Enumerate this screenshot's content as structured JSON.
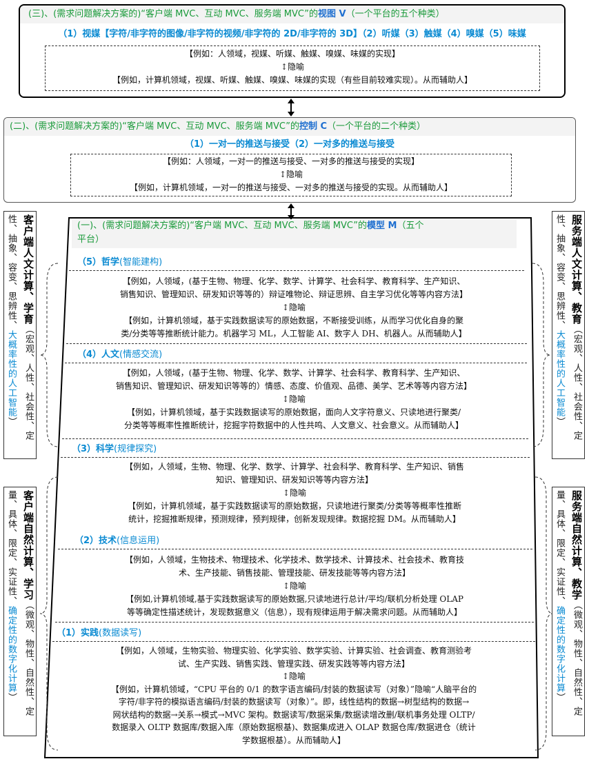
{
  "view": {
    "header_prefix": "(三)、(需求问题解决方案的)“客户端 MVC、互动 MVC、服务端 MVC”的",
    "header_bold": "视图 V",
    "header_suffix": "（一个平台的五个种类）",
    "sub": "（1）视媒【字符/非字符的图像/非字符的视频/非字符的 2D/非字符的 3D】（2）听媒（3）触媒（4）嗅媒（5）味媒",
    "human": "【例如：人领域，视媒、听媒、触媒、嗅媒、味媒的实现】",
    "metaphor": "↕隐喻",
    "machine": "【例如，计算机领域，视媒、听媒、触媒、嗅媒、味媒的实现（有些目前较难实现）。从而辅助人】"
  },
  "control": {
    "header_prefix": "(二)、(需求问题解决方案的)“客户端 MVC、互动 MVC、服务端 MVC”的",
    "header_bold": "控制 C",
    "header_suffix": "（一个平台的二个种类）",
    "sub": "（1）一对一的推送与接受（2）一对多的推送与接受",
    "human": "【例如：人领域，一对一的推送与接受、一对多的推送与接受的实现】",
    "metaphor": "↕隐喻",
    "machine": "【例如，计算机领域，一对一的推送与接受、一对多的推送与接受的实现。从而辅助人】"
  },
  "model": {
    "header_line1_prefix": "(一)、(需求问题解决方案的)“客户端 MVC、互动 MVC、服务端 MVC”的",
    "header_bold": "模型 M",
    "header_line1_suffix": "（五个",
    "header_line2": "平台）",
    "sections": [
      {
        "title": "（5）哲学",
        "note": "(智能建构)",
        "human": [
          "【例如，人领域，(基于生物、物理、化学、数学、计算学、社会科学、教育科学、生产知识、",
          "销售知识、管理知识、研发知识等等的）辩证唯物论、辩证思辨、自主学习优化等等内容方法】"
        ],
        "metaphor": "↕隐喻",
        "machine": [
          "【例如，计算机领域，基于实践数据读写的原始数据，不断接受训练，从而学习优化自身的聚",
          "类/分类等等推断统计能力。机器学习 ML，人工智能 AI、数字人 DH、机器人。从而辅助人】"
        ]
      },
      {
        "title": "（4）人文",
        "note": "(情感交流)",
        "human": [
          "【例如，人领域，(基于生物、物理、化学、数学、计算学、社会科学、教育科学、生产知识、",
          "销售知识、管理知识、研发知识等等的）情感、态度、价值观、品德、美学、艺术等等内容方法】"
        ],
        "metaphor": "↕隐喻",
        "machine": [
          "【例如，计算机领域，基于实践数据读写的原始数据，面向人文字符意义、只读地进行聚类/",
          "分类等等概率性推断统计，挖掘字符数据中的人性共鸣、人文意义、社会意义。从而辅助人】"
        ]
      },
      {
        "title": "（3）科学",
        "note": "(规律探究)",
        "human": [
          "【例如，人领域，生物、物理、化学、数学、计算学、社会科学、教育科学、生产知识、销售",
          "知识、管理知识、研发知识等等内容方法】"
        ],
        "metaphor": "↕隐喻",
        "machine": [
          "【例如，计算机领域，基于实践数据读写的原始数据，只读地进行聚类/分类等等概率性推断",
          "统计，挖掘推断规律，预测规律，预判规律，创新发现规律。数据挖掘 DM。从而辅助人】"
        ]
      },
      {
        "title": "（2）技术",
        "note": "(信息运用)",
        "human": [
          "【例如，人领域，生物技术、物理技术、化学技术、数学技术、计算技术、社会技术、教育技",
          "术、生产技能、销售技能、管理技能、研发技能等等内容方法】"
        ],
        "metaphor": "↕隐喻",
        "machine": [
          "【例如,计算机领域,基于实践数据读写的原始数据,只读地进行总计/平均/联机分析处理 OLAP",
          "等等确定性描述统计，发现数据意义（信息），现有规律运用于解决需求问题。从而辅助人】"
        ]
      },
      {
        "title": "（1）实践",
        "note": "(数据读写)",
        "human": [
          "【例如，人领域，生物实验、物理实验、化学实验、数学实验、计算实验、社会调查、教育测验考",
          "试、生产实践、销售实践、管理实践、研发实践等等内容方法】"
        ],
        "metaphor": "↕隐喻",
        "machine": [
          "【例如，计算机领域，“CPU 平台的 0/1 的数字语言编码/封装的数据读写（对象）”隐喻“人脑平台的",
          "字符/非字符的模拟语言编码/封装的数据读写（对象）”。即，线性结构的数据→树型结构的数据→",
          "网状结构的数据→关系→模式→MVC 架构。数据读写/数据采集/数据读增改删/联机事务处理 OLTP/",
          "数据录入 OLTP 数据库/数据入库（原始数据根基)、数据集成进入 OLAP 数据仓库/数据进仓（统计",
          "学数据根基）。从而辅助人】"
        ]
      }
    ]
  },
  "side": {
    "left_top": {
      "bold": "客户端人文计算、学育",
      "prefix": "性、抽象、容变、思辨性、",
      "mid": "（宏观、人性、社会性、定",
      "blue": "大概率性的人工智能",
      "end": "）"
    },
    "right_top": {
      "bold": "服务端人文计算、教育",
      "prefix": "性、抽象、容变、思辨性、",
      "mid": "（宏观、人性、社会性、定",
      "blue": "大概率性的人工智能",
      "end": "）"
    },
    "left_bottom": {
      "bold": "客户端自然计算、学习",
      "prefix": "量、具体、限定、实证性、",
      "mid": "（微观、物性、自然性、定",
      "blue": "确定性的数字化计算",
      "end": "）"
    },
    "right_bottom": {
      "bold": "服务端自然计算、教学",
      "prefix": "量、具体、限定、实证性、",
      "mid": "（微观、物性、自然性、定",
      "blue": "确定性的数字化计算",
      "end": "）"
    }
  }
}
